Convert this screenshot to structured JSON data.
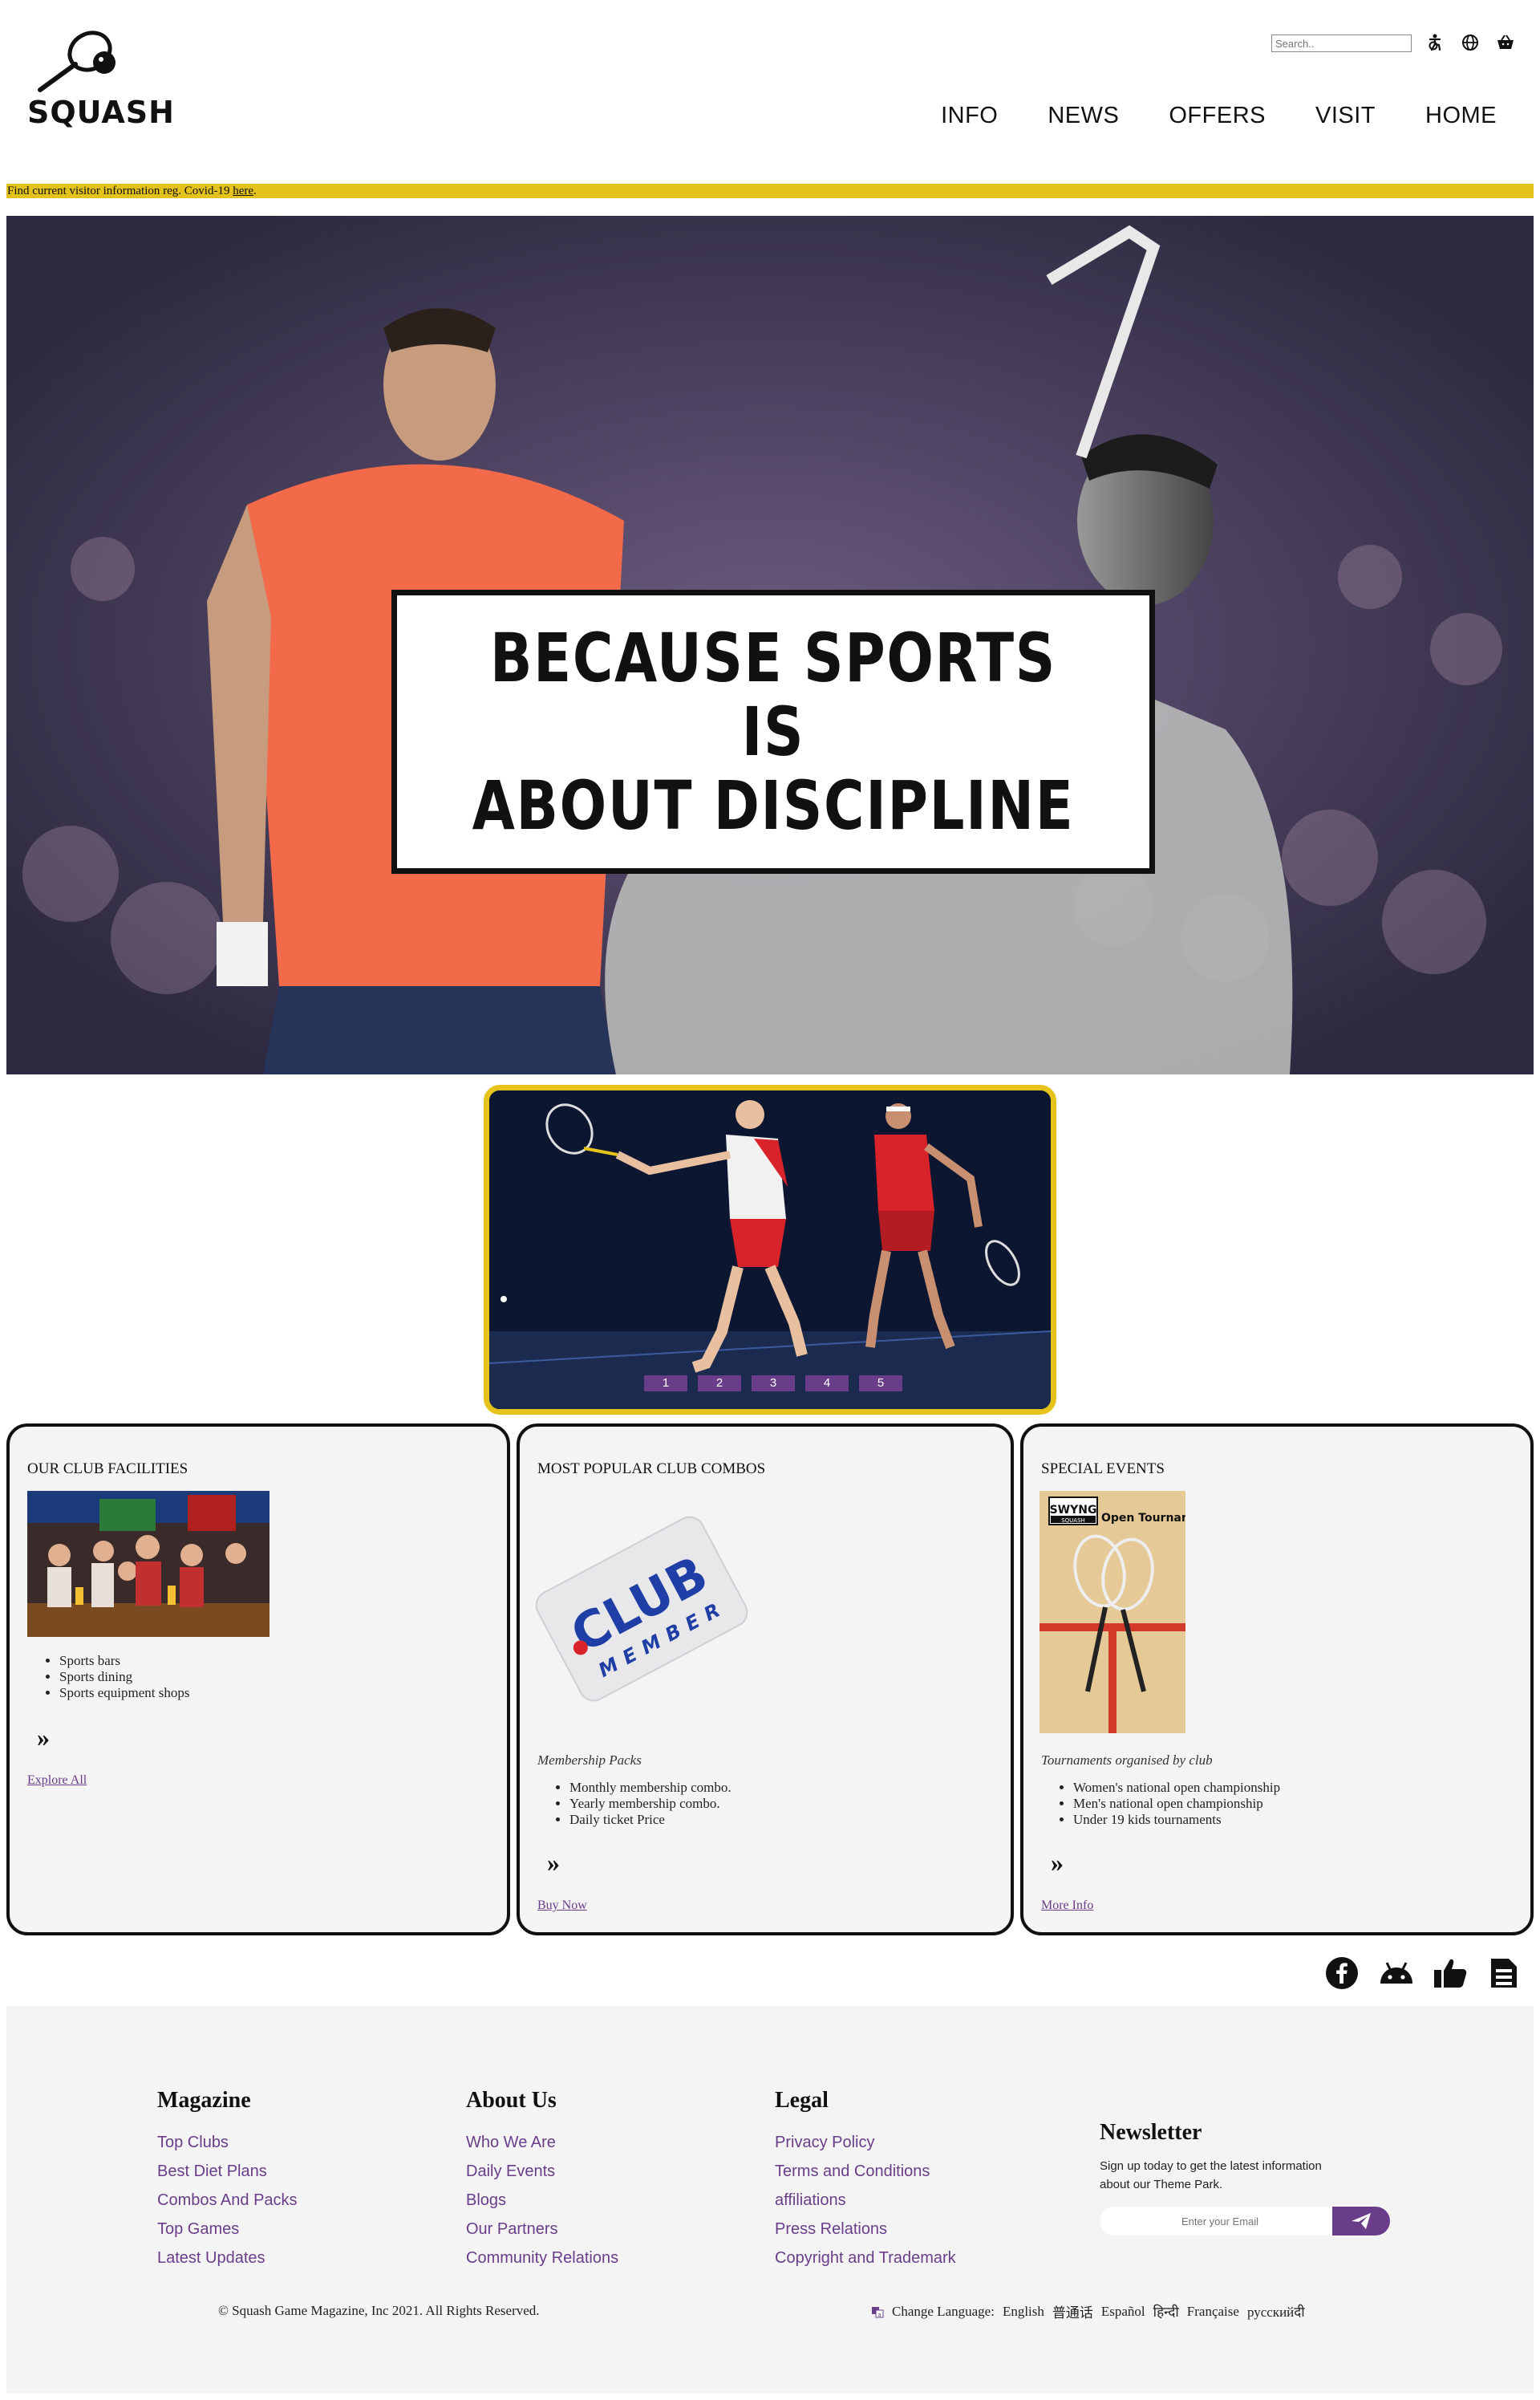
{
  "header": {
    "logo_text": "SQUASH",
    "search_placeholder": "Search..",
    "nav": [
      "INFO",
      "NEWS",
      "OFFERS",
      "VISIT",
      "HOME"
    ]
  },
  "banner": {
    "text": "Find current visitor information reg. Covid-19 ",
    "link": "here",
    "suffix": "."
  },
  "hero": {
    "title_line1": "BECAUSE SPORTS IS",
    "title_line2": "ABOUT DISCIPLINE"
  },
  "slider": {
    "dots": [
      "1",
      "2",
      "3",
      "4",
      "5"
    ],
    "accent": "#e5c31a",
    "dot_color": "#6a3d8a"
  },
  "cards": [
    {
      "title": "OUR CLUB FACILITIES",
      "items": [
        "Sports bars",
        "Sports dining",
        "Sports equipment shops"
      ],
      "chevron": "»",
      "link": "Explore All"
    },
    {
      "title": "MOST POPULAR CLUB COMBOS",
      "image_text": "CLUB",
      "image_subtext": "MEMBER",
      "caption": "Membership Packs",
      "items": [
        "Monthly membership combo.",
        "Yearly membership combo.",
        "Daily ticket Price"
      ],
      "chevron": "»",
      "link": "Buy Now"
    },
    {
      "title": "SPECIAL EVENTS",
      "poster_brand": "SWYNG",
      "poster_sub": "SQUASH",
      "poster_title": "Open Tournament",
      "caption": "Tournaments organised by club",
      "items": [
        "Women's national open championship",
        "Men's national open championship",
        "Under 19 kids tournaments"
      ],
      "chevron": "»",
      "link": "More Info"
    }
  ],
  "social": [
    "facebook-icon",
    "android-icon",
    "thumbs-up-icon",
    "document-icon"
  ],
  "footer": {
    "columns": [
      {
        "title": "Magazine",
        "links": [
          "Top Clubs",
          "Best Diet Plans",
          "Combos And Packs",
          "Top Games",
          "Latest Updates"
        ]
      },
      {
        "title": "About Us",
        "links": [
          "Who We Are",
          "Daily Events",
          "Blogs",
          "Our Partners",
          "Community Relations"
        ]
      },
      {
        "title": "Legal",
        "links": [
          "Privacy Policy",
          "Terms and Conditions",
          "affiliations",
          "Press Relations",
          "Copyright and Trademark"
        ]
      }
    ],
    "newsletter": {
      "title": "Newsletter",
      "text": "Sign up today to get the latest information about our Theme Park.",
      "placeholder": "Enter your Email"
    },
    "copyright": "© Squash Game Magazine, Inc 2021. All Rights Reserved.",
    "language_label": "Change Language:",
    "languages": [
      "English",
      "普通话",
      "Español",
      "हिन्दी",
      "Française",
      "русскийदी"
    ]
  },
  "colors": {
    "accent_purple": "#6a3d8a",
    "banner_yellow": "#e2c21b",
    "card_bg": "#f4f4f4"
  }
}
